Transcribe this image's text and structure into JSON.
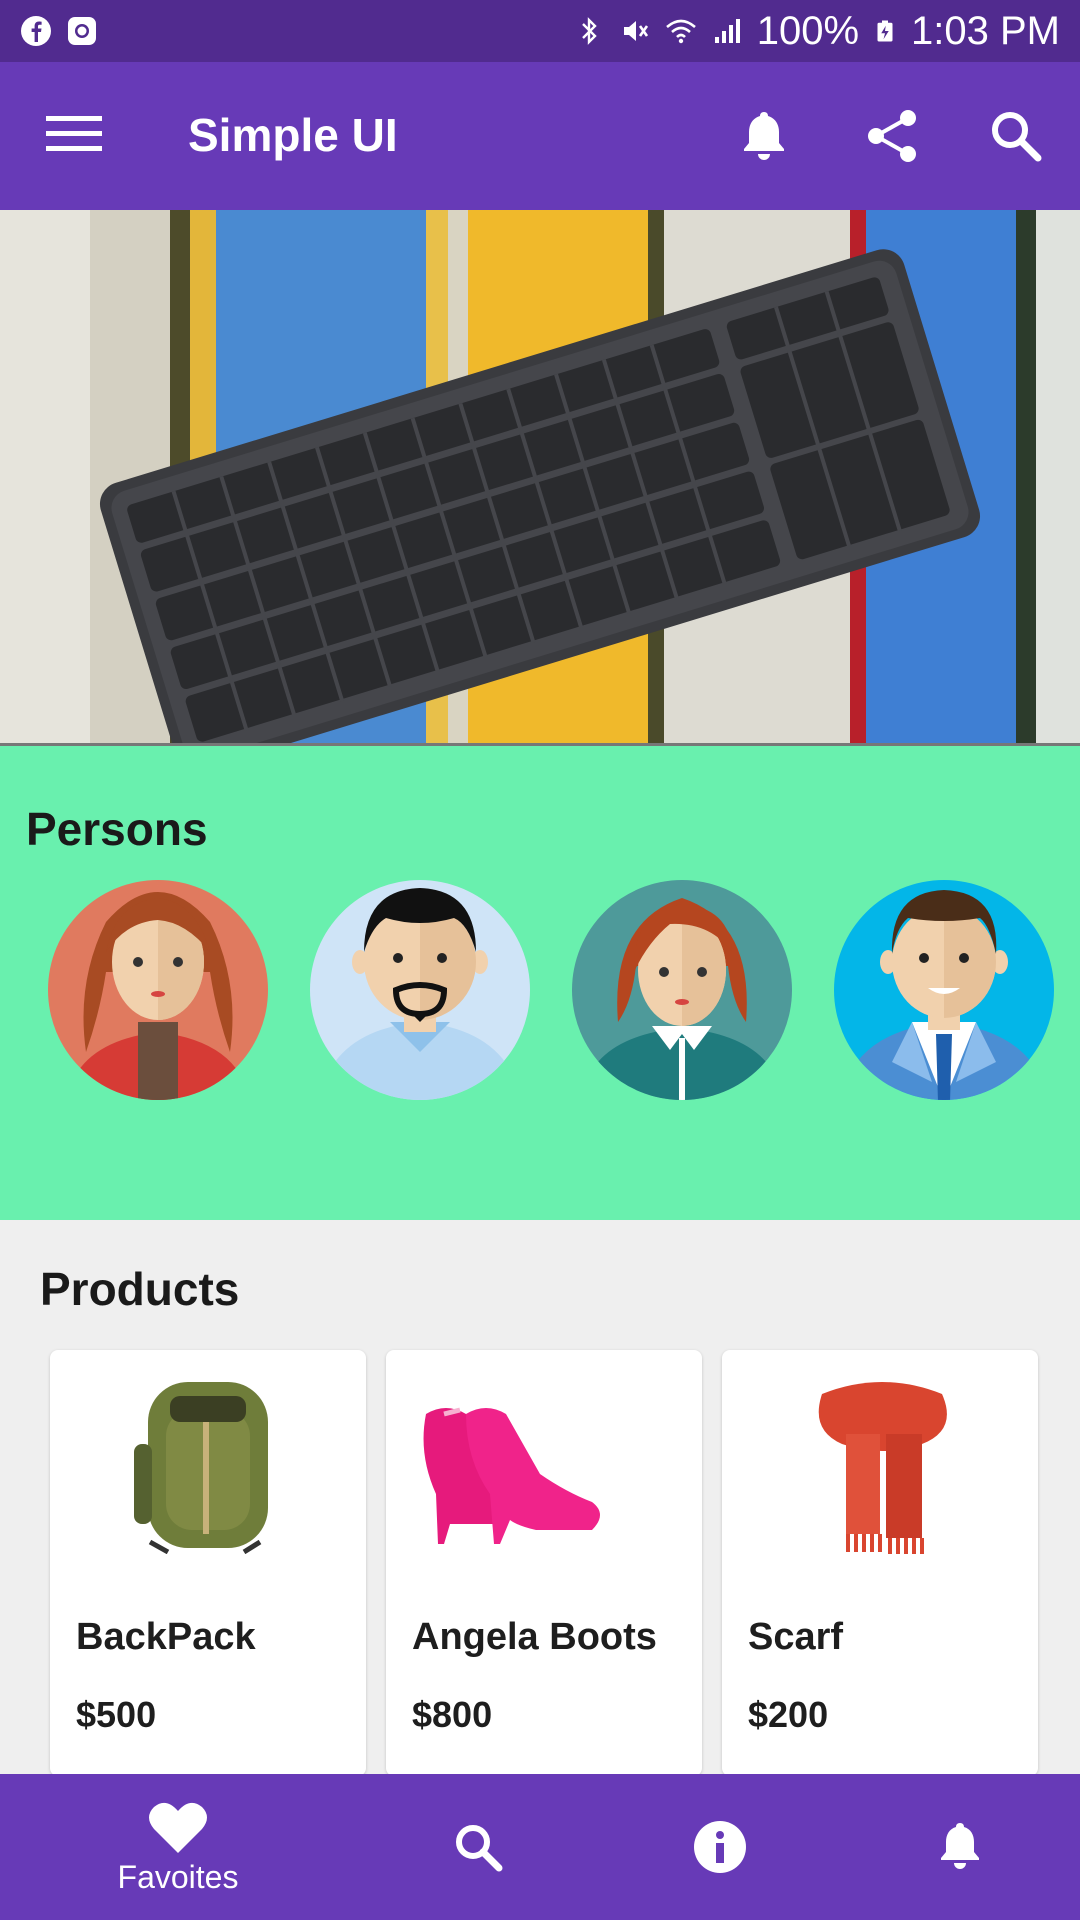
{
  "status_bar": {
    "battery": "100%",
    "time": "1:03 PM",
    "left_icons": [
      "facebook-icon",
      "instagram-icon"
    ],
    "right_icons": [
      "bluetooth-icon",
      "mute-icon",
      "wifi-icon",
      "signal-icon",
      "battery-charging-icon"
    ]
  },
  "app_bar": {
    "title": "Simple UI",
    "actions": [
      "bell-icon",
      "share-icon",
      "search-icon"
    ]
  },
  "persons": {
    "title": "Persons",
    "avatars": [
      "woman-curly-hair",
      "man-beard",
      "woman-red-hair",
      "man-suit"
    ]
  },
  "products": {
    "title": "Products",
    "items": [
      {
        "name": "BackPack",
        "price": "$500"
      },
      {
        "name": "Angela Boots",
        "price": "$800"
      },
      {
        "name": "Scarf",
        "price": "$200"
      }
    ]
  },
  "bottom_nav": {
    "items": [
      {
        "label": "Favoites",
        "icon": "heart-icon"
      },
      {
        "label": "",
        "icon": "search-icon"
      },
      {
        "label": "",
        "icon": "info-icon"
      },
      {
        "label": "",
        "icon": "bell-icon"
      }
    ]
  },
  "colors": {
    "status_bar": "#512b8f",
    "primary": "#673ab7",
    "persons_bg": "#69f0ae",
    "page_bg": "#efefef"
  }
}
